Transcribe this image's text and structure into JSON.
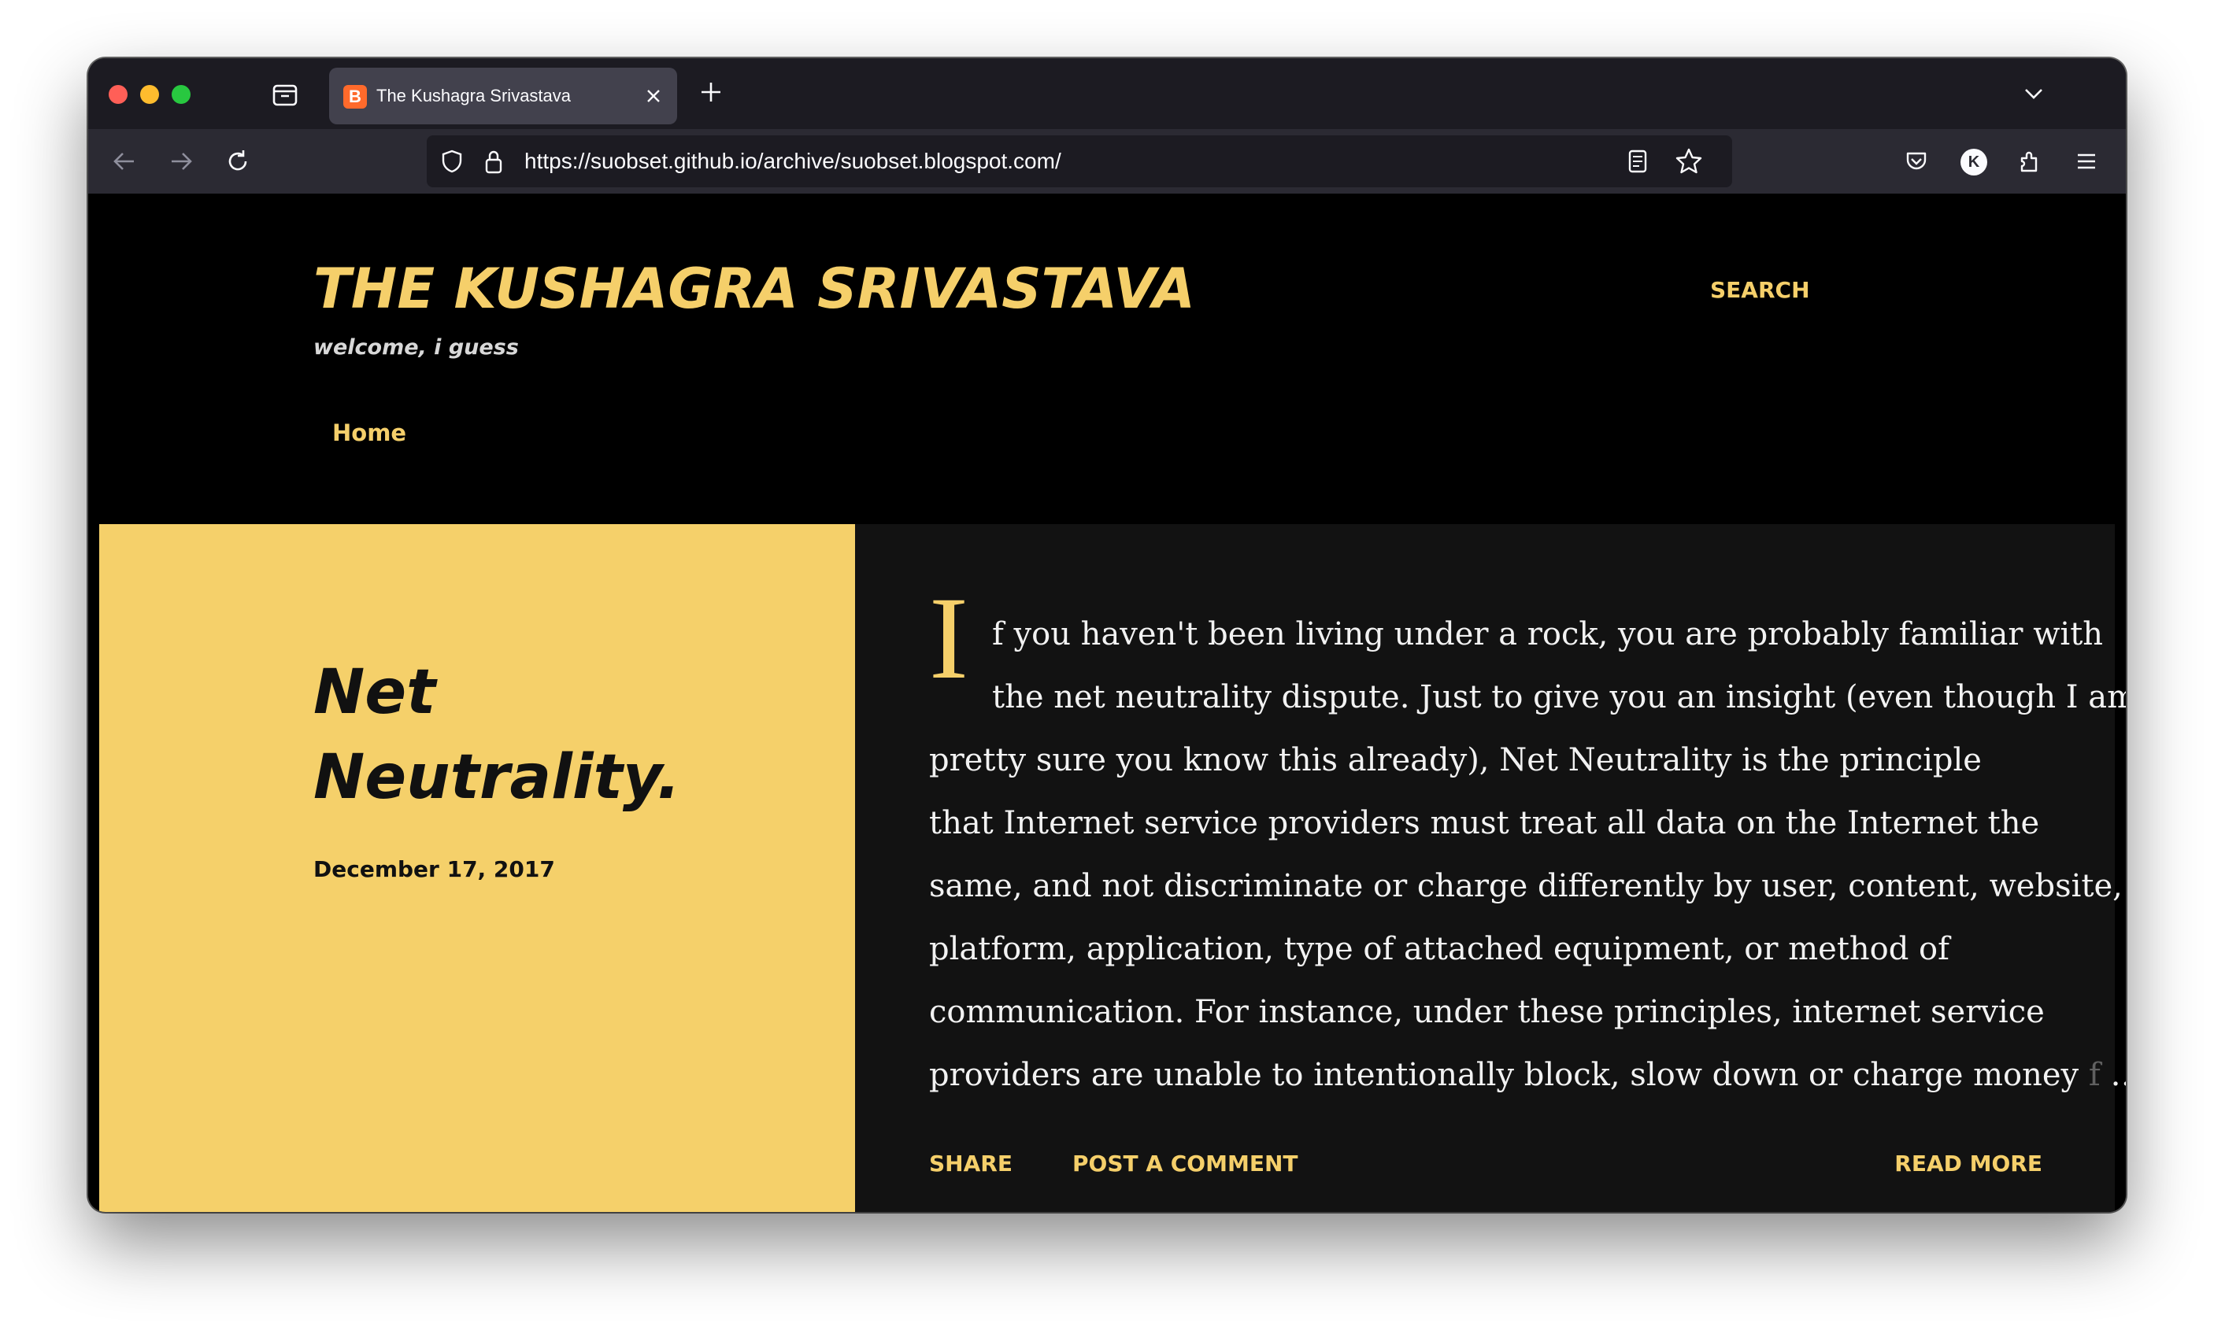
{
  "browser": {
    "tab_title": "The Kushagra Srivastava",
    "url": "https://suobset.github.io/archive/suobset.blogspot.com/",
    "account_initial": "K",
    "favicon_letter": "B"
  },
  "blog": {
    "title": "THE KUSHAGRA SRIVASTAVA",
    "description": "welcome, i guess",
    "search_label": "SEARCH",
    "nav": {
      "home_label": "Home"
    }
  },
  "post": {
    "title_line1": "Net",
    "title_line2": "Neutrality.",
    "date": "December 17, 2017",
    "dropcap": "I",
    "lines": [
      "f you haven't been living under a rock, you are probably familiar with",
      "the net neutrality dispute. Just to give you an insight (even though I am",
      "pretty sure you know this already), Net Neutrality is the principle",
      "that  Internet service providers must treat all data on the Internet the",
      "same, and not discriminate or charge differently by user, content, website,",
      "platform, application, type of attached equipment, or method of",
      "communication. For instance, under these principles, internet service",
      "providers are unable to intentionally block, slow down or charge money"
    ],
    "fade_text": "f",
    "ellipsis": "…",
    "share_label": "SHARE",
    "comment_label": "POST A COMMENT",
    "read_more_label": "READ MORE"
  },
  "colors": {
    "accent": "#f5cf6a",
    "page_bg": "#000000",
    "post_left_bg": "#f5d06a",
    "post_right_bg": "#121212"
  }
}
